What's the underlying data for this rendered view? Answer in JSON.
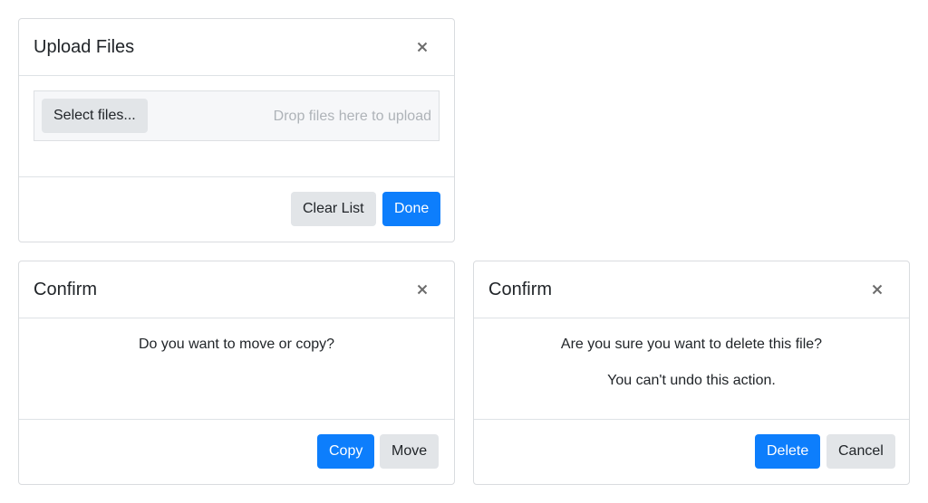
{
  "colors": {
    "primary": "#0d7efc",
    "secondary": "#e2e5e8",
    "border": "#dee2e6",
    "placeholder": "#aeb3b8"
  },
  "upload_dialog": {
    "title": "Upload Files",
    "close_icon": "close-icon",
    "select_label": "Select files...",
    "drop_hint": "Drop files here to upload",
    "clear_label": "Clear List",
    "done_label": "Done"
  },
  "move_dialog": {
    "title": "Confirm",
    "close_icon": "close-icon",
    "message": "Do you want to move or copy?",
    "copy_label": "Copy",
    "move_label": "Move"
  },
  "delete_dialog": {
    "title": "Confirm",
    "close_icon": "close-icon",
    "message": "Are you sure you want to delete this file?",
    "warning": "You can't undo this action.",
    "delete_label": "Delete",
    "cancel_label": "Cancel"
  }
}
